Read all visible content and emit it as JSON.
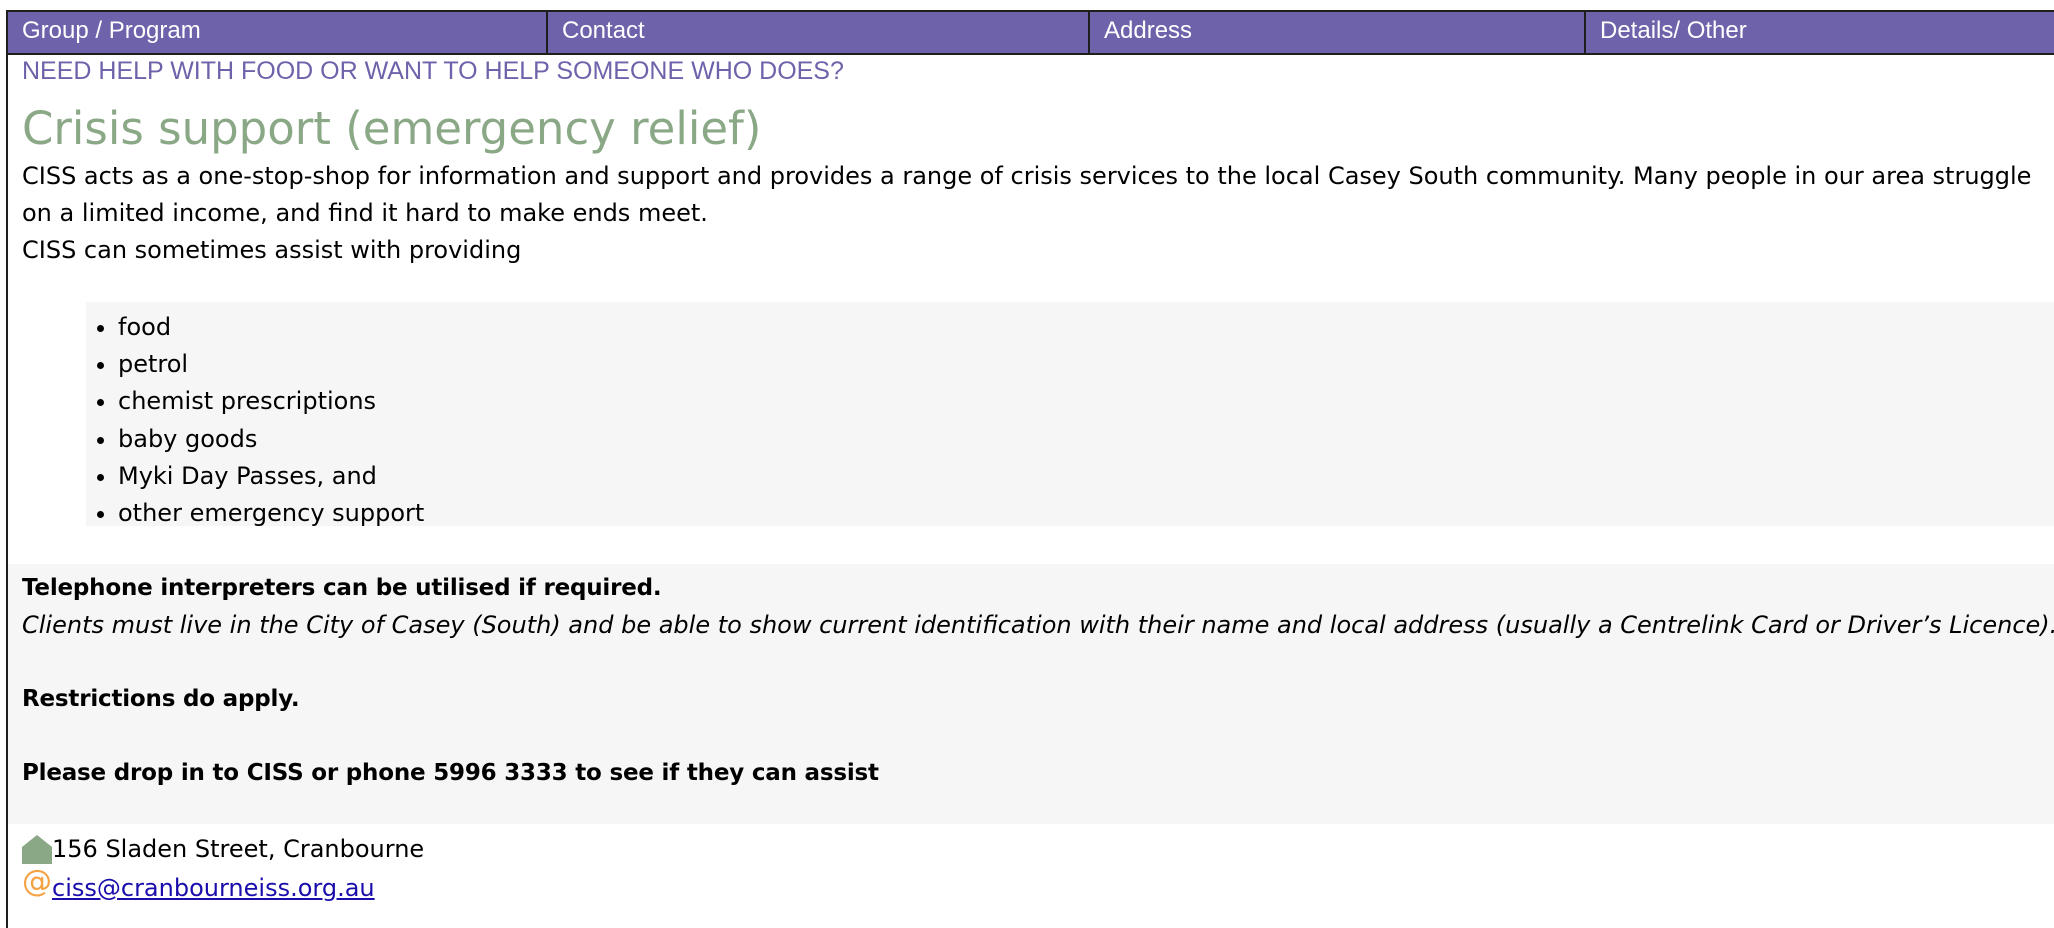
{
  "header": {
    "columns": [
      "Group / Program",
      "Contact",
      "Address",
      "Details/ Other"
    ]
  },
  "content": {
    "kicker": "NEED HELP WITH FOOD OR WANT TO HELP SOMEONE WHO DOES?",
    "title": "Crisis support (emergency relief)",
    "intro": "CISS acts as a one-stop-shop for information and support and provides a range of crisis services to the local Casey South community. Many people in our area struggle on a limited income, and find it hard to make ends meet.",
    "lead_in": "CISS can sometimes assist with providing",
    "services": [
      "food",
      "petrol",
      "chemist prescriptions",
      "baby goods",
      "Myki Day Passes, and",
      "other emergency support"
    ],
    "interpreters_note": "Telephone interpreters can be utilised if required.",
    "eligibility_note": "Clients must live in the City of Casey (South) and be able to show current identification with their name and local address (usually a Centrelink Card or Driver’s Licence).",
    "restrictions_note": "Restrictions do apply.",
    "drop_in_note": "Please drop in to CISS or phone 5996 3333 to see if they can assist"
  },
  "contact": {
    "address": "156 Sladen Street, Cranbourne",
    "address_icon": "house-icon",
    "email": "ciss@cranbourneiss.org.au",
    "email_icon": "at-icon"
  },
  "colors": {
    "header_bg": "#6e63ab",
    "heading": "#8aa886",
    "kicker": "#6e63ab",
    "panel_bg": "#f6f6f6",
    "email_icon": "#f5a243",
    "house_icon": "#8aa886"
  }
}
